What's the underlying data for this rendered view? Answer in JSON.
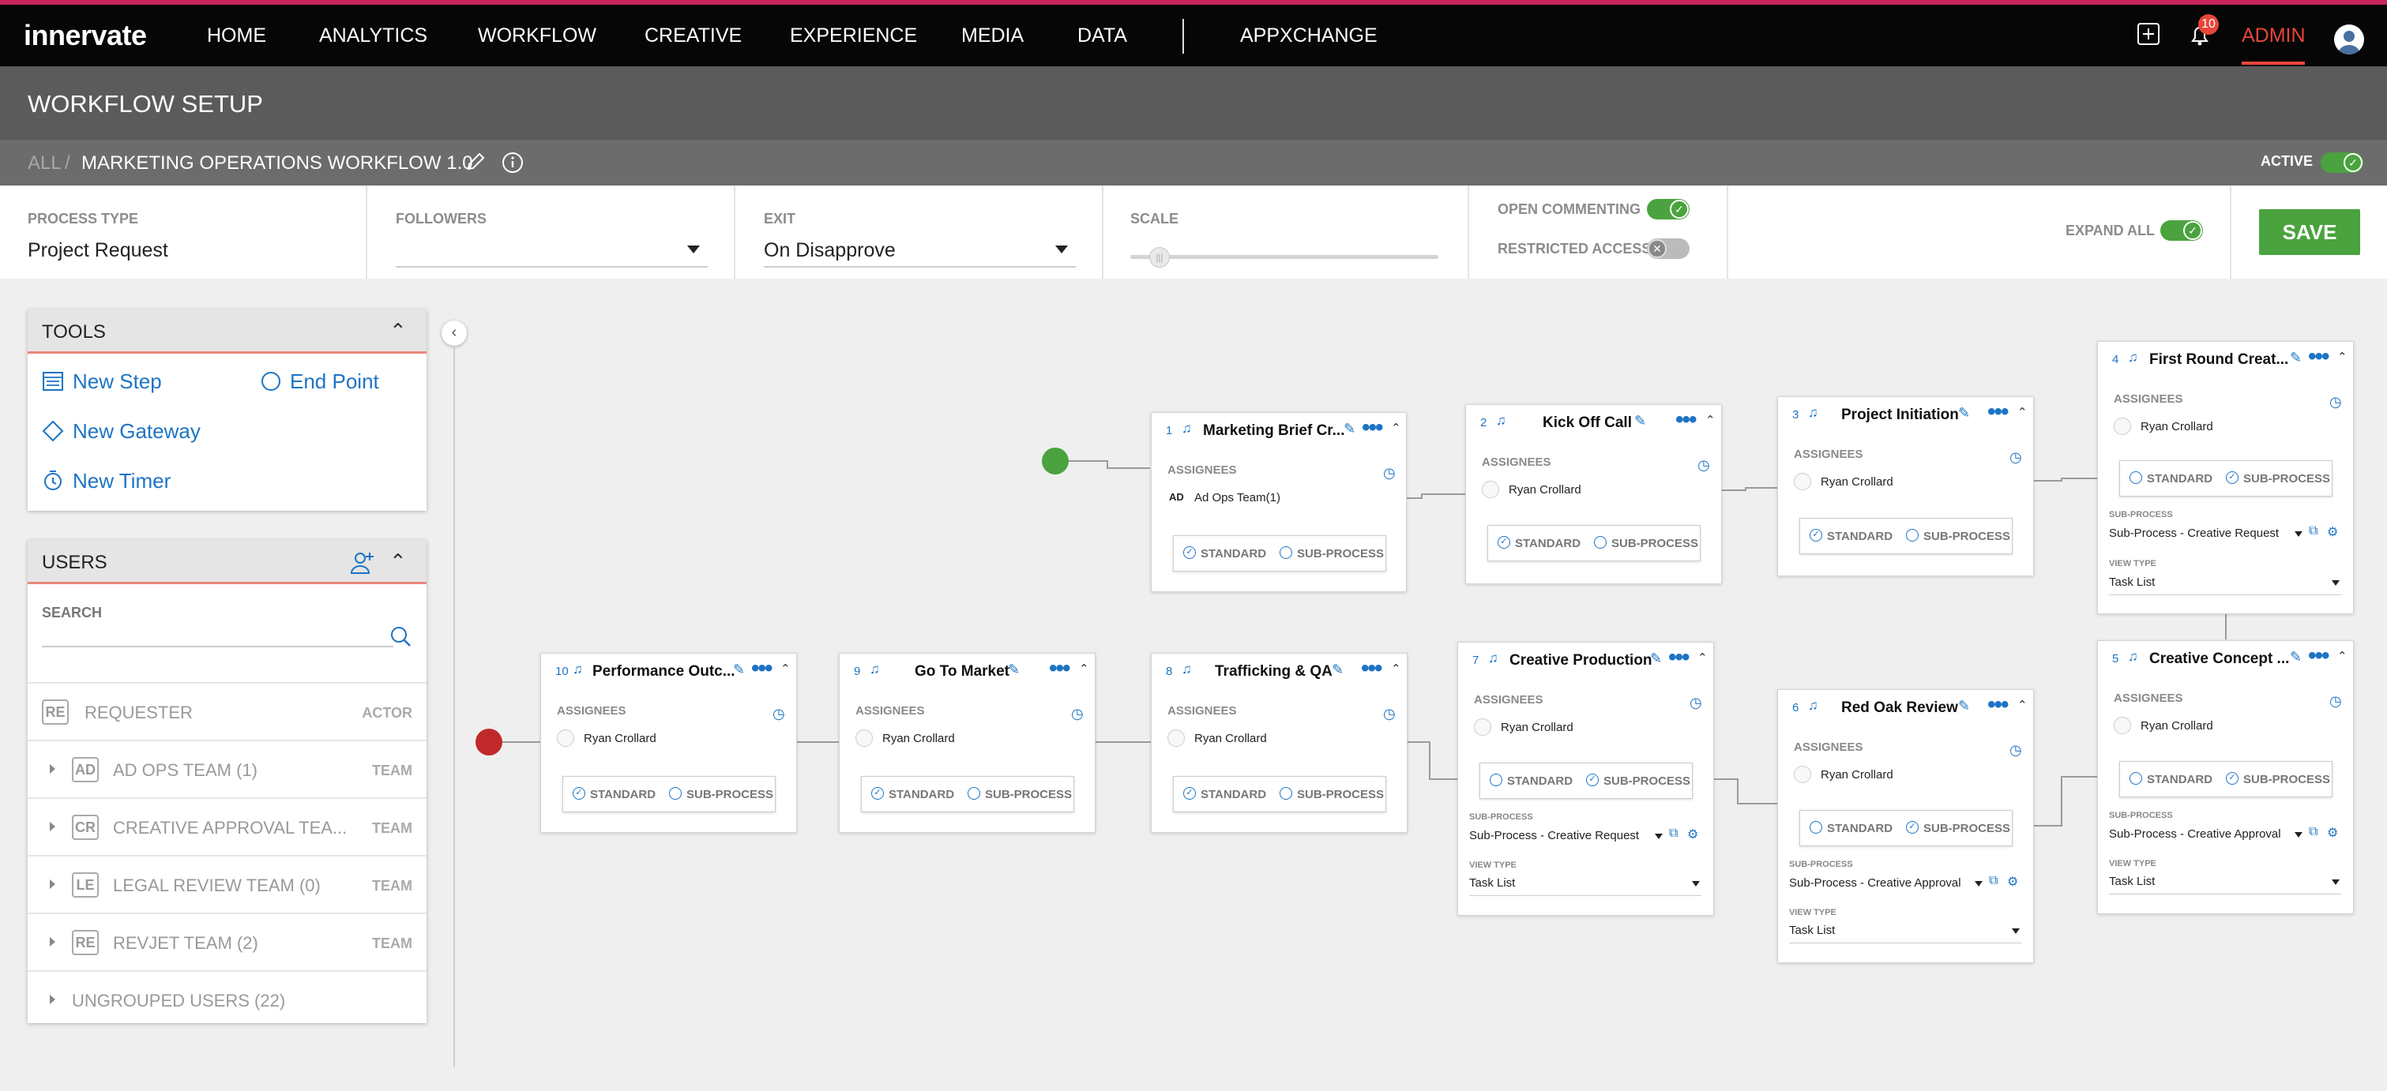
{
  "brand": {
    "logo": "innervate"
  },
  "nav": {
    "items": [
      "HOME",
      "ANALYTICS",
      "WORKFLOW",
      "CREATIVE",
      "EXPERIENCE",
      "MEDIA",
      "DATA"
    ],
    "appxchange": "APPXCHANGE",
    "admin": "ADMIN",
    "notification_count": "10",
    "accent": "#e8463a"
  },
  "page": {
    "title": "WORKFLOW SETUP",
    "crumb_all": "ALL",
    "crumb_sep": "/",
    "workflow_name": "MARKETING OPERATIONS WORKFLOW 1.0",
    "active_label": "ACTIVE"
  },
  "controls": {
    "process_type_label": "PROCESS TYPE",
    "process_type_value": "Project Request",
    "followers_label": "FOLLOWERS",
    "followers_value": "",
    "exit_label": "EXIT",
    "exit_value": "On Disapprove",
    "scale_label": "SCALE",
    "open_commenting": "OPEN COMMENTING",
    "restricted_access": "RESTRICTED ACCESS",
    "expand_all": "EXPAND ALL",
    "save": "SAVE"
  },
  "tools": {
    "title": "TOOLS",
    "new_step": "New Step",
    "end_point": "End Point",
    "new_gateway": "New Gateway",
    "new_timer": "New Timer"
  },
  "users": {
    "title": "USERS",
    "search_label": "SEARCH",
    "requester": {
      "abbr": "RE",
      "name": "REQUESTER",
      "type": "ACTOR"
    },
    "teams": [
      {
        "abbr": "AD",
        "name": "AD OPS TEAM (1)",
        "type": "TEAM"
      },
      {
        "abbr": "CR",
        "name": "CREATIVE APPROVAL TEA...",
        "type": "TEAM"
      },
      {
        "abbr": "LE",
        "name": "LEGAL REVIEW TEAM (0)",
        "type": "TEAM"
      },
      {
        "abbr": "RE",
        "name": "REVJET TEAM (2)",
        "type": "TEAM"
      }
    ],
    "ungrouped": "UNGROUPED USERS (22)"
  },
  "labels": {
    "assignees": "ASSIGNEES",
    "standard": "STANDARD",
    "sub_process": "SUB-PROCESS",
    "view_type": "VIEW TYPE"
  },
  "steps": [
    {
      "num": "1",
      "title": "Marketing Brief Cr...",
      "assignee": "Ad Ops Team(1)",
      "tag": "AD",
      "mode": "standard"
    },
    {
      "num": "2",
      "title": "Kick Off Call",
      "assignee": "Ryan Crollard",
      "mode": "standard"
    },
    {
      "num": "3",
      "title": "Project Initiation",
      "assignee": "Ryan Crollard",
      "mode": "standard"
    },
    {
      "num": "4",
      "title": "First Round Creat...",
      "assignee": "Ryan Crollard",
      "mode": "sub",
      "sub_process": "Sub-Process - Creative Request",
      "view_type": "Task List"
    },
    {
      "num": "5",
      "title": "Creative Concept ...",
      "assignee": "Ryan Crollard",
      "mode": "sub",
      "sub_process": "Sub-Process - Creative Approval",
      "view_type": "Task List"
    },
    {
      "num": "6",
      "title": "Red Oak Review",
      "assignee": "Ryan Crollard",
      "mode": "sub",
      "sub_process": "Sub-Process - Creative Approval",
      "view_type": "Task List"
    },
    {
      "num": "7",
      "title": "Creative Production",
      "assignee": "Ryan Crollard",
      "mode": "sub",
      "sub_process": "Sub-Process - Creative Request",
      "view_type": "Task List"
    },
    {
      "num": "8",
      "title": "Trafficking & QA",
      "assignee": "Ryan Crollard",
      "mode": "standard"
    },
    {
      "num": "9",
      "title": "Go To Market",
      "assignee": "Ryan Crollard",
      "mode": "standard"
    },
    {
      "num": "10",
      "title": "Performance Outc...",
      "assignee": "Ryan Crollard",
      "mode": "standard"
    }
  ],
  "colors": {
    "start": "#4aa33e",
    "end": "#c0292b",
    "accent_blue": "#1d74c4",
    "save": "#4aa33e"
  }
}
